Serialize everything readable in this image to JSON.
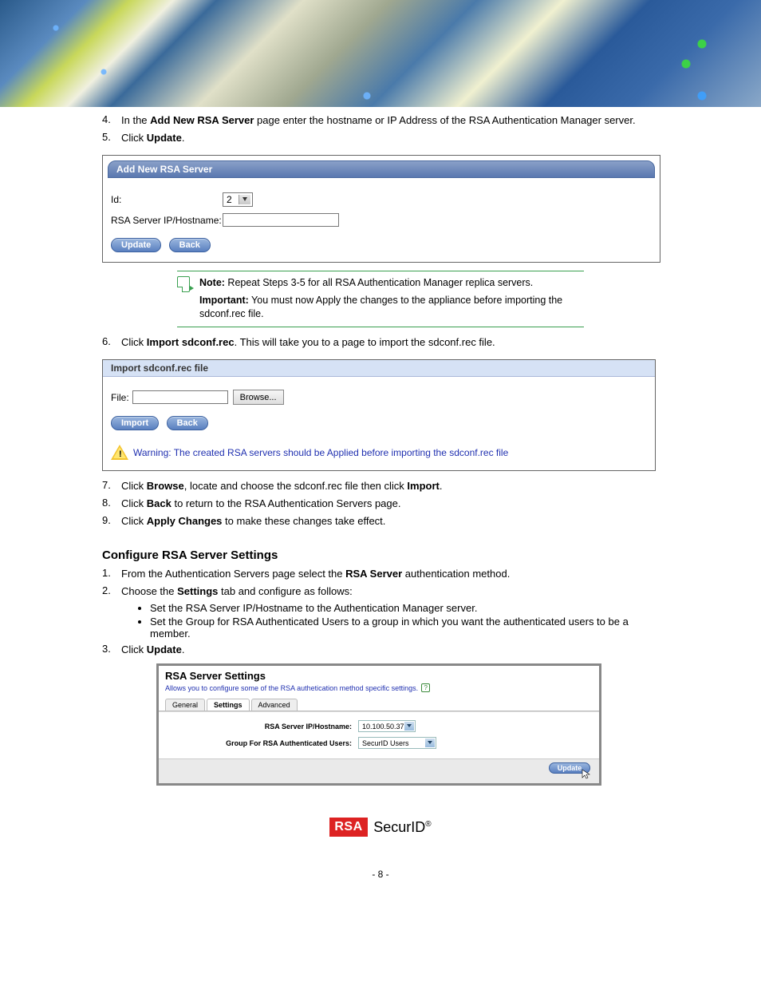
{
  "steps_a": {
    "n4": "4.",
    "t4_pre": "In the ",
    "t4_b": "Add New RSA Server",
    "t4_post": " page enter the hostname or IP Address of the RSA Authentication Manager server.",
    "n5": "5.",
    "t5_pre": "Click ",
    "t5_b": "Update",
    "t5_post": "."
  },
  "panel1": {
    "title": "Add New RSA Server",
    "label_id": "Id:",
    "id_value": "2",
    "label_host": "RSA Server IP/Hostname:",
    "host_value": "",
    "btn_update": "Update",
    "btn_back": "Back"
  },
  "callout": {
    "b1": "Note:",
    "t1": " Repeat Steps 3-5 for all RSA Authentication Manager replica servers.",
    "b2": "Important:",
    "t2": " You must now Apply the changes to the appliance before importing the sdconf.rec file."
  },
  "steps_b": {
    "n6": "6.",
    "t6_pre": "Click ",
    "t6_b": "Import sdconf.rec",
    "t6_post": ". This will take you to a page to import the sdconf.rec file."
  },
  "panel2": {
    "title": "Import sdconf.rec file",
    "file_label": "File:",
    "file_value": "",
    "btn_browse": "Browse...",
    "btn_import": "Import",
    "btn_back": "Back",
    "warn": "Warning: The created RSA servers should be Applied before importing the sdconf.rec file"
  },
  "steps_c": {
    "n7": "7.",
    "t7_pre": "Click ",
    "t7_b1": "Browse",
    "t7_mid": ", locate and choose the sdconf.rec file then click ",
    "t7_b2": "Import",
    "t7_post": ".",
    "n8": "8.",
    "t8_pre": "Click ",
    "t8_b": "Back",
    "t8_post": " to return to the RSA Authentication Servers page.",
    "n9": "9.",
    "t9_pre": "Click ",
    "t9_b": "Apply Changes",
    "t9_post": " to make these changes take effect."
  },
  "config_heading": "Configure RSA Server Settings",
  "steps_d": {
    "n1": "1.",
    "t1_pre": "From the Authentication Servers page select the ",
    "t1_b": "RSA Server",
    "t1_post": " authentication method.",
    "n2": "2.",
    "t2_pre": "Choose the ",
    "t2_b": "Settings",
    "t2_post": " tab and configure as follows:"
  },
  "bullets": {
    "b1": "Set the RSA Server IP/Hostname to the Authentication Manager server.",
    "b2": "Set the Group for RSA Authenticated Users to a group in which you want the authenticated users to be a member."
  },
  "steps_e": {
    "n3": "3.",
    "t3_pre": "Click ",
    "t3_b": "Update",
    "t3_post": "."
  },
  "panel3": {
    "title": "RSA Server Settings",
    "sub": "Allows you to configure some of the RSA authetication method specific settings.",
    "tabs": {
      "general": "General",
      "settings": "Settings",
      "advanced": "Advanced"
    },
    "label_host": "RSA Server IP/Hostname:",
    "host_value": "10.100.50.37",
    "label_group": "Group For RSA Authenticated Users:",
    "group_value": "SecurID Users",
    "btn_update": "Update"
  },
  "footer": {
    "page_left": "- ",
    "page_num": "8",
    "page_right": " -",
    "logo_rsa": "RSA",
    "logo_securid": "SecurID"
  }
}
